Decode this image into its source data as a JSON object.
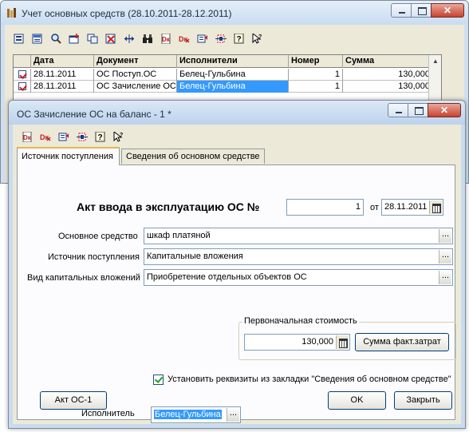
{
  "main_window": {
    "title": "Учет основных средств (28.10.2011-28.12.2011)",
    "toolbar_icons": [
      "new-document-icon",
      "edit-document-icon",
      "find-icon",
      "add-row-icon",
      "copy-icon",
      "delete-icon",
      "resize-columns-icon",
      "binoculars-icon",
      "dk-report-icon",
      "dk-report-red-icon",
      "settings-icon",
      "date-range-icon",
      "help-icon",
      "pointer-help-icon"
    ],
    "grid": {
      "columns": [
        "Дата",
        "Документ",
        "Исполнители",
        "Номер",
        "Сумма"
      ],
      "rows": [
        {
          "date": "28.11.2011",
          "document": "ОС Поступ.ОС",
          "executor": "Белец-Гульбина",
          "number": "1",
          "sum": "130,000"
        },
        {
          "date": "28.11.2011",
          "document": "ОС Зачисление ОС",
          "executor": "Белец-Гульбина",
          "number": "1",
          "sum": "130,000"
        }
      ]
    }
  },
  "dialog": {
    "title": "ОС Зачисление ОС на баланс - 1 *",
    "toolbar_icons": [
      "dk-report-icon",
      "dk-report-red-icon",
      "settings-icon",
      "date-range-icon",
      "help-icon",
      "pointer-help-icon"
    ],
    "tabs": [
      "Источник поступления",
      "Сведения об основном средстве"
    ],
    "act_label": "Акт ввода в эксплуатацию ОС №",
    "act_number": "1",
    "from_label": "от",
    "act_date": "28.11.2011",
    "fixed_asset_label": "Основное средство",
    "fixed_asset_value": "шкаф платяной",
    "source_label": "Источник поступления",
    "source_value": "Капитальные вложения",
    "capital_label": "Вид капитальных вложений",
    "capital_value": "Приобретение отдельных объектов ОС",
    "initial_cost_group": "Первоначальная стоимость",
    "initial_cost_value": "130,000",
    "actual_costs_button": "Сумма факт.затрат",
    "checkbox_label": "Установить реквизиты из закладки \"Сведения об основном средстве\"",
    "checkbox_checked": true,
    "act_button": "Акт ОС-1",
    "ok_button": "OK",
    "close_button": "Закрыть",
    "executor_label": "Исполнитель",
    "executor_value": "Белец-Гульбина"
  },
  "colors": {
    "title_bar": "#c9dcf1",
    "client": "#ece9d8",
    "tab_page": "#fcfcfe",
    "selection": "#3399ff"
  }
}
